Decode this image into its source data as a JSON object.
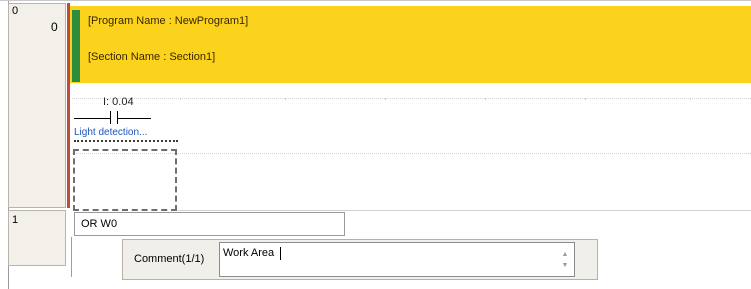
{
  "rungs": [
    {
      "number": "0",
      "step": "0"
    },
    {
      "number": "1"
    }
  ],
  "header": {
    "program_line": "[Program Name : NewProgram1]",
    "section_line": "[Section Name : Section1]"
  },
  "contact": {
    "address": "I: 0.04",
    "comment": "Light detection..."
  },
  "instruction_entry": {
    "value": "OR W0"
  },
  "comment_entry": {
    "label": "Comment(1/1)",
    "value": "Work Area"
  },
  "colors": {
    "header_band": "#fcd31c",
    "header_marker": "#2e8c3a",
    "power_rail": "#c24a36",
    "comment_text": "#1a55c4"
  }
}
